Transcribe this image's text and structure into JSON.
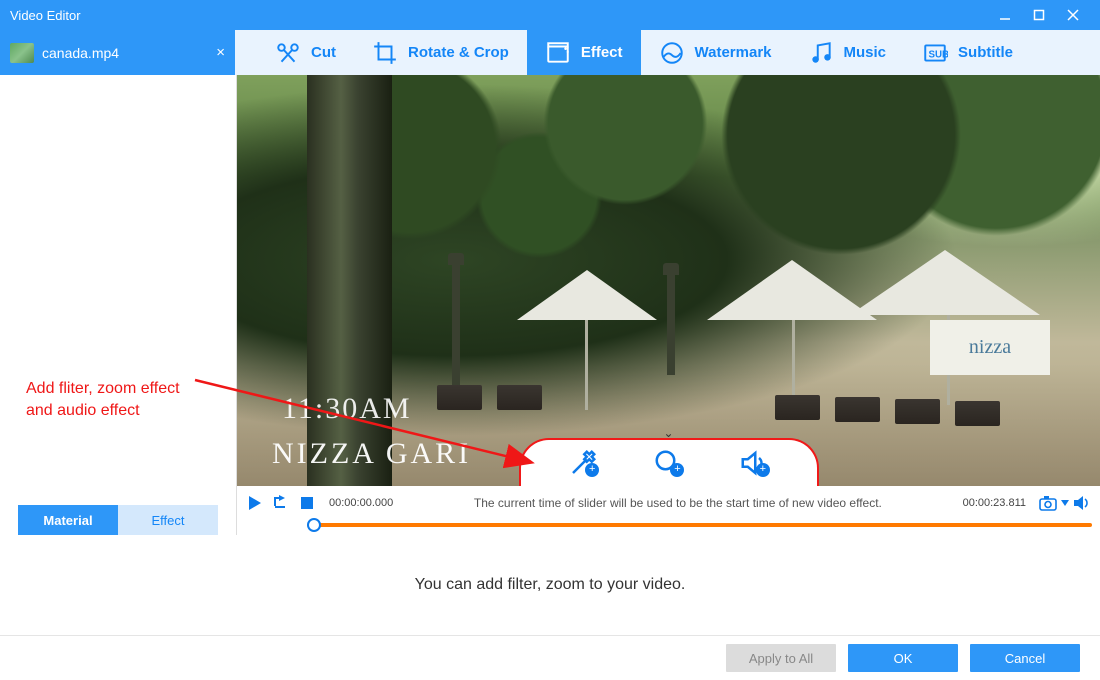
{
  "window": {
    "title": "Video Editor"
  },
  "file_tab": {
    "name": "canada.mp4"
  },
  "toolbar": [
    {
      "key": "cut",
      "label": "Cut"
    },
    {
      "key": "rotate",
      "label": "Rotate & Crop"
    },
    {
      "key": "effect",
      "label": "Effect",
      "active": true
    },
    {
      "key": "watermark",
      "label": "Watermark"
    },
    {
      "key": "music",
      "label": "Music"
    },
    {
      "key": "subtitle",
      "label": "Subtitle"
    }
  ],
  "sidebar_tabs": {
    "material": "Material",
    "effect": "Effect"
  },
  "annotation": {
    "line1": "Add fliter, zoom effect",
    "line2": "and audio effect"
  },
  "video_overlay": {
    "time": "11:30AM",
    "title": "NIZZA GARI",
    "sign": "nizza"
  },
  "player": {
    "current_time": "00:00:00.000",
    "total_time": "00:00:23.811",
    "hint": "The current time of slider will be used to be the start time of new video effect."
  },
  "mid_message": "You can add filter, zoom to your video.",
  "footer": {
    "apply_all": "Apply to All",
    "ok": "OK",
    "cancel": "Cancel"
  }
}
